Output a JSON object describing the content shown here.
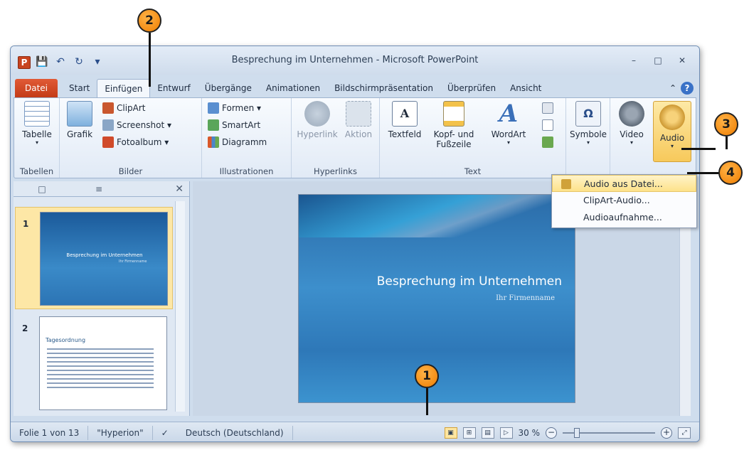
{
  "window": {
    "title": "Besprechung im Unternehmen  -  Microsoft PowerPoint",
    "app_icon": "P",
    "controls": [
      "–",
      "□",
      "✕"
    ]
  },
  "tabs": {
    "file": "Datei",
    "items": [
      "Start",
      "Einfügen",
      "Entwurf",
      "Übergänge",
      "Animationen",
      "Bildschirmpräsentation",
      "Überprüfen",
      "Ansicht"
    ],
    "active": "Einfügen",
    "help": "?"
  },
  "ribbon": {
    "tabellen": {
      "button": "Tabelle",
      "label": "Tabellen"
    },
    "bilder": {
      "grafik": "Grafik",
      "clipart": "ClipArt",
      "screenshot": "Screenshot ▾",
      "fotoalbum": "Fotoalbum ▾",
      "label": "Bilder"
    },
    "illustrationen": {
      "formen": "Formen ▾",
      "smartart": "SmartArt",
      "diagramm": "Diagramm",
      "label": "Illustrationen"
    },
    "hyperlinks": {
      "hyperlink": "Hyperlink",
      "aktion": "Aktion",
      "label": "Hyperlinks"
    },
    "text": {
      "textfeld": "Textfeld",
      "kopf": "Kopf- und Fußzeile",
      "wordart": "WordArt",
      "label": "Text"
    },
    "symbole": {
      "button": "Symbole"
    },
    "media": {
      "video": "Video",
      "audio": "Audio"
    }
  },
  "audio_menu": {
    "items": [
      "Audio aus Datei...",
      "ClipArt-Audio...",
      "Audioaufnahme..."
    ]
  },
  "slides_pane": {
    "slides": [
      {
        "num": "1",
        "title": "Besprechung im Unternehmen",
        "sub": "Ihr Firmenname"
      },
      {
        "num": "2",
        "title": "Tagesordnung"
      }
    ]
  },
  "slide": {
    "title": "Besprechung im Unternehmen",
    "subtitle": "Ihr Firmenname"
  },
  "statusbar": {
    "slide_info": "Folie 1 von 13",
    "theme": "\"Hyperion\"",
    "language": "Deutsch (Deutschland)",
    "zoom": "30 %"
  },
  "callouts": [
    "1",
    "2",
    "3",
    "4"
  ]
}
